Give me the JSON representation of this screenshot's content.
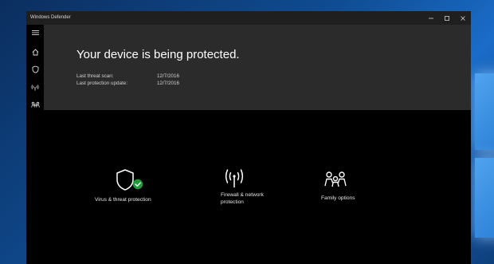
{
  "window": {
    "title": "Windows Defender"
  },
  "sidebar": {
    "items": [
      {
        "icon": "hamburger-icon"
      },
      {
        "icon": "home-icon"
      },
      {
        "icon": "shield-icon"
      },
      {
        "icon": "network-icon"
      },
      {
        "icon": "family-icon"
      }
    ]
  },
  "hero": {
    "title": "Your device is being protected.",
    "last_scan_label": "Last threat scan:",
    "last_scan_value": "12/7/2016",
    "last_update_label": "Last protection update:",
    "last_update_value": "12/7/2016"
  },
  "tiles": [
    {
      "label": "Virus & threat protection",
      "icon": "shield-check-icon"
    },
    {
      "label_line1": "Firewall & network",
      "label_line2": "protection",
      "icon": "antenna-icon"
    },
    {
      "label": "Family options",
      "icon": "family-icon"
    }
  ],
  "colors": {
    "hero_bg": "#2b2b2b",
    "accent_green": "#1e9c3a",
    "desktop_blue": "#1a6cc8"
  }
}
